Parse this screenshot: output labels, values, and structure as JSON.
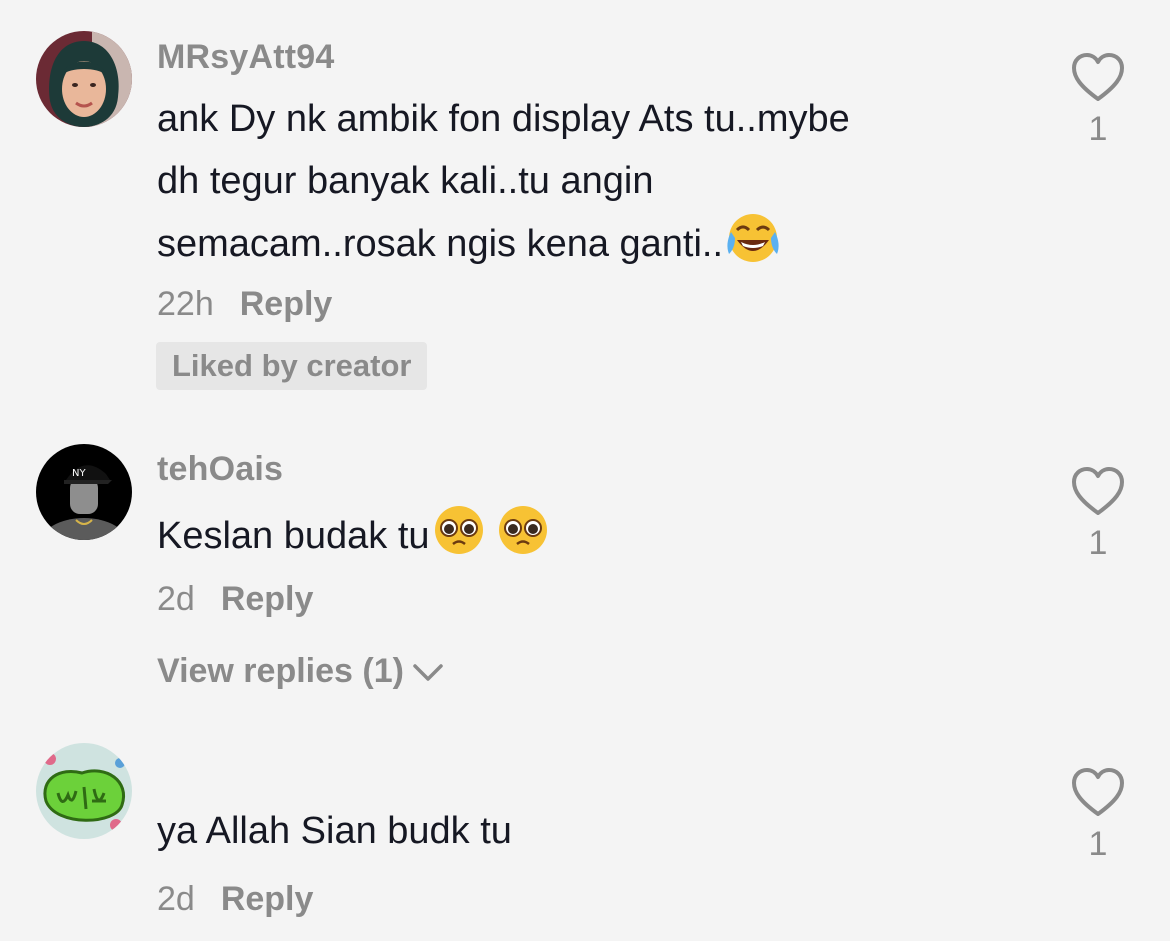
{
  "comments": [
    {
      "username": "MRsyAtt94",
      "text": "ank Dy nk ambik fon display Ats tu..mybe\ndh tegur banyak kali..tu angin\nsemacam..rosak ngis kena ganti..",
      "emoji": "face-with-tears-of-joy",
      "time": "22h",
      "reply_label": "Reply",
      "badge": "Liked by creator",
      "likes": "1"
    },
    {
      "username": "tehOais",
      "text": "Keslan budak tu",
      "emoji": "pleading-face",
      "time": "2d",
      "reply_label": "Reply",
      "view_replies": "View replies (1)",
      "likes": "1"
    },
    {
      "username": "",
      "text": "ya Allah Sian budk tu",
      "time": "2d",
      "reply_label": "Reply",
      "likes": "1"
    }
  ],
  "icons": {
    "like": "heart-outline-icon",
    "expand": "chevron-down-icon"
  },
  "colors": {
    "background": "#f4f4f4",
    "primary_text": "#161823",
    "secondary_text": "#8a8a8a",
    "badge_bg": "#e6e6e6"
  }
}
